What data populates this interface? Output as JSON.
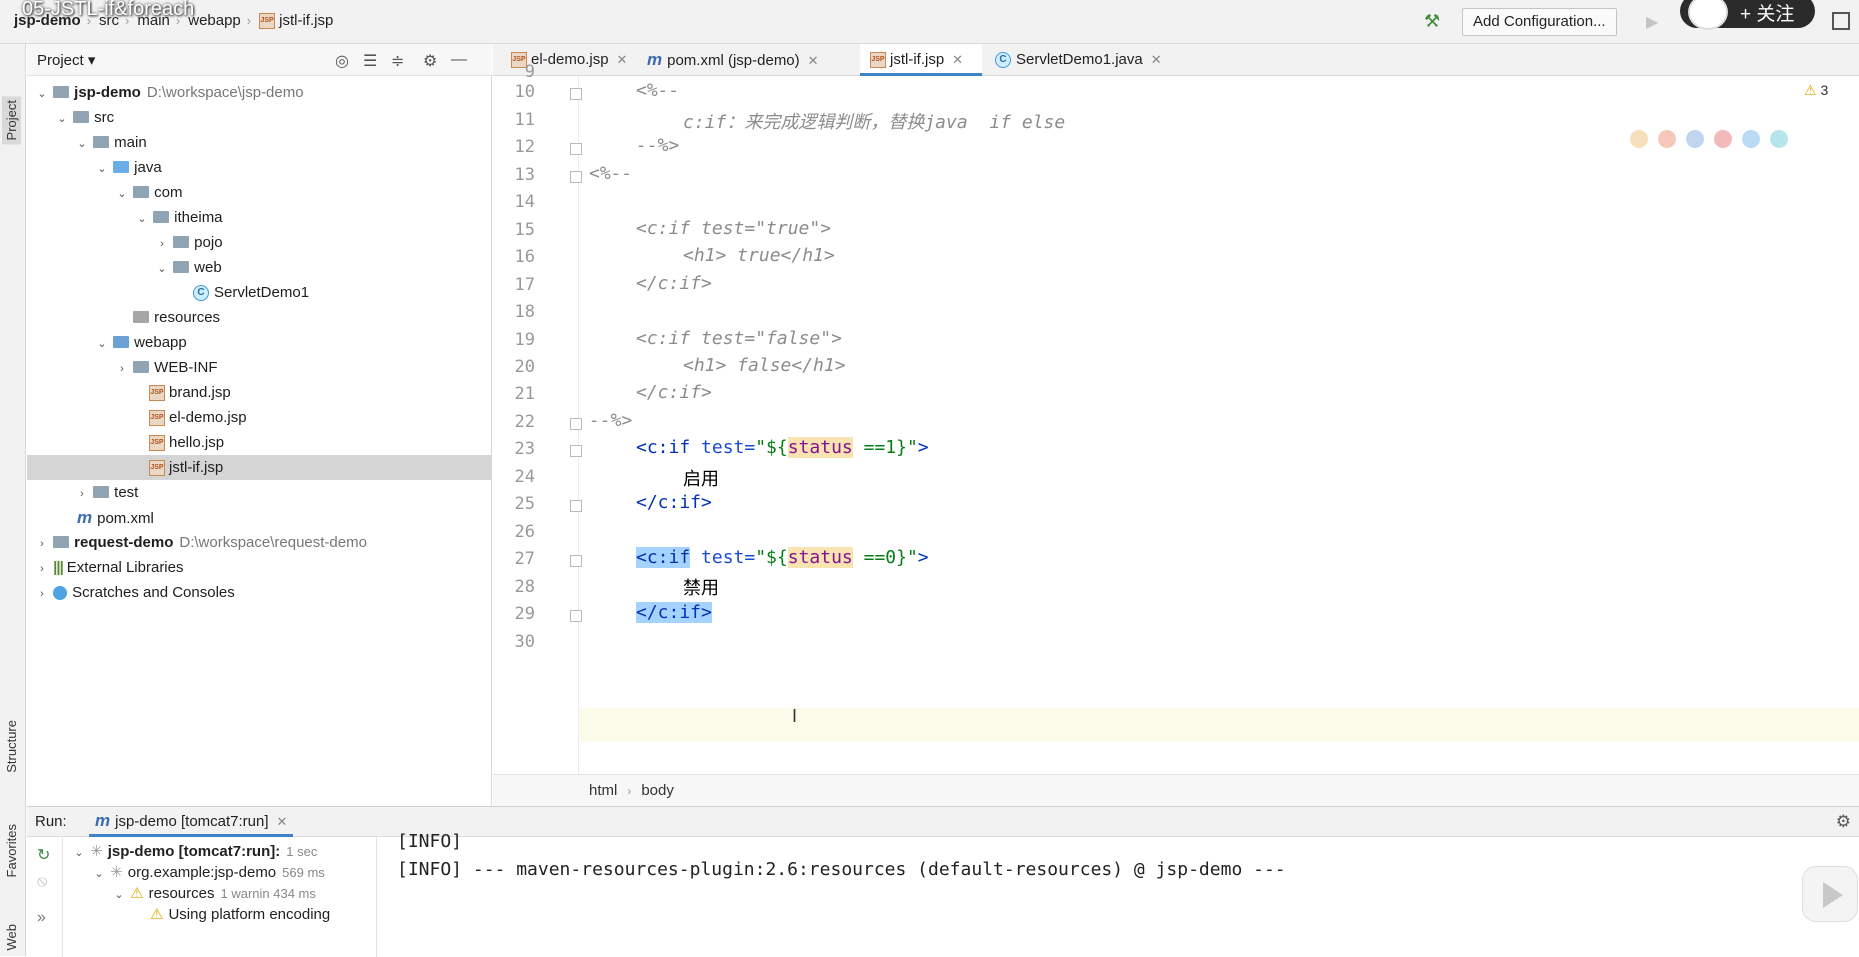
{
  "video_overlay": {
    "title": "05-JSTL-if&foreach",
    "follow_label": "+ 关注"
  },
  "nav": {
    "breadcrumb": [
      "jsp-demo",
      "src",
      "main",
      "webapp",
      "jstl-if.jsp"
    ],
    "add_configuration": "Add Configuration..."
  },
  "side_tabs": {
    "project": "Project",
    "structure": "Structure",
    "favorites": "Favorites",
    "web": "Web"
  },
  "project_panel": {
    "title": "Project",
    "tree": [
      {
        "label": "jsp-demo",
        "path": "D:\\workspace\\jsp-demo"
      },
      {
        "label": "src"
      },
      {
        "label": "main"
      },
      {
        "label": "java"
      },
      {
        "label": "com"
      },
      {
        "label": "itheima"
      },
      {
        "label": "pojo"
      },
      {
        "label": "web"
      },
      {
        "label": "ServletDemo1"
      },
      {
        "label": "resources"
      },
      {
        "label": "webapp"
      },
      {
        "label": "WEB-INF"
      },
      {
        "label": "brand.jsp"
      },
      {
        "label": "el-demo.jsp"
      },
      {
        "label": "hello.jsp"
      },
      {
        "label": "jstl-if.jsp"
      },
      {
        "label": "test"
      },
      {
        "label": "pom.xml"
      },
      {
        "label": "request-demo",
        "path": "D:\\workspace\\request-demo"
      },
      {
        "label": "External Libraries"
      },
      {
        "label": "Scratches and Consoles"
      }
    ]
  },
  "editor_tabs": [
    {
      "label": "el-demo.jsp"
    },
    {
      "label": "pom.xml (jsp-demo)"
    },
    {
      "label": "jstl-if.jsp"
    },
    {
      "label": "ServletDemo1.java"
    }
  ],
  "editor": {
    "warnings": "3",
    "line_numbers": [
      "9",
      "10",
      "11",
      "12",
      "13",
      "14",
      "15",
      "16",
      "17",
      "18",
      "19",
      "20",
      "21",
      "22",
      "23",
      "24",
      "25",
      "26",
      "27",
      "28",
      "29",
      "30"
    ],
    "lines": {
      "l10": "<%--",
      "l11": "c:if：来完成逻辑判断，替换java  if else",
      "l12": "--%>",
      "l13": "<%--",
      "l15": "<c:if test=\"true\">",
      "l16": "<h1> true</h1>",
      "l17": "</c:if>",
      "l19": "<c:if test=\"false\">",
      "l20": "<h1> false</h1>",
      "l21": "</c:if>",
      "l22": "--%>",
      "l23_open": "<c:if",
      "l23_attr": "test=",
      "l23_q1": "\"${",
      "l23_var": "status",
      "l23_rest": " ==1}",
      "l23_q2": "\"",
      "l23_close": ">",
      "l24": "启用",
      "l25": "</c:if>",
      "l27_open": "<c:if",
      "l27_attr": "test=",
      "l27_q1": "\"${",
      "l27_var": "status",
      "l27_rest": " ==0}",
      "l27_q2": "\"",
      "l27_close": ">",
      "l28": "禁用",
      "l29": "</c:if>"
    },
    "breadcrumb": [
      "html",
      "body"
    ]
  },
  "run_panel": {
    "label": "Run:",
    "tab": "jsp-demo [tomcat7:run]",
    "tree": [
      {
        "label": "jsp-demo [tomcat7:run]:",
        "time": "1 sec"
      },
      {
        "label": "org.example:jsp-demo",
        "time": "569 ms"
      },
      {
        "label": "resources",
        "time": "1 warnin 434 ms"
      },
      {
        "label": "Using platform encoding"
      }
    ],
    "console": [
      "[INFO]",
      "[INFO] --- maven-resources-plugin:2.6:resources (default-resources) @ jsp-demo ---"
    ]
  }
}
